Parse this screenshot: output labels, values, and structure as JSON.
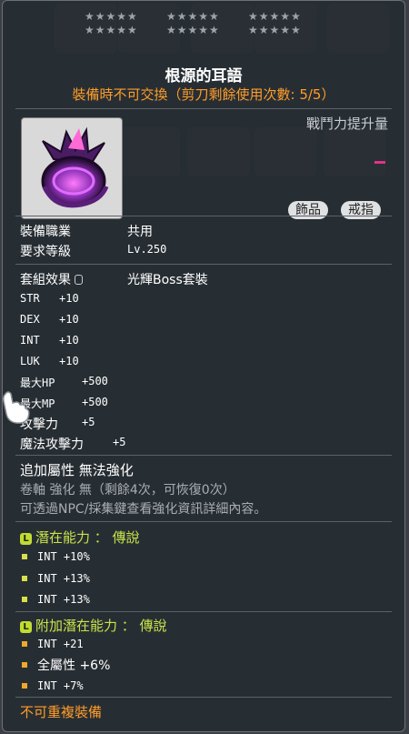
{
  "item": {
    "title": "根源的耳語",
    "trade_note": "裝備時不可交換（剪刀剩餘使用次數: 5/5）",
    "power_label": "戰鬥力提升量",
    "tags": [
      "飾品",
      "戒指"
    ]
  },
  "info": {
    "job_label": "裝備職業",
    "job_value": "共用",
    "level_label": "要求等級",
    "level_value": "Lv.250",
    "set_label": "套組效果",
    "set_value": "光輝Boss套裝"
  },
  "stats": [
    {
      "label": "STR",
      "value": "+10"
    },
    {
      "label": "DEX",
      "value": "+10"
    },
    {
      "label": "INT",
      "value": "+10"
    },
    {
      "label": "LUK",
      "value": "+10"
    },
    {
      "label": "最大HP",
      "value": "+500"
    },
    {
      "label": "最大MP",
      "value": "+500"
    },
    {
      "label": "攻擊力",
      "value": "+5"
    },
    {
      "label": "魔法攻擊力",
      "value": "+5"
    }
  ],
  "enhance": {
    "attr_line": "追加屬性 無法強化",
    "scroll_line": "卷軸 強化 無（剩餘4次，可恢復0次）",
    "npc_line": "可透過NPC/採集鍵查看強化資訊詳細內容。"
  },
  "potential": {
    "badge": "L",
    "title": "潛在能力 ： 傳說",
    "lines": [
      "INT +10%",
      "INT +13%",
      "INT +13%"
    ]
  },
  "bonus_potential": {
    "badge": "L",
    "title": "附加潛在能力 ： 傳說",
    "lines": [
      "INT +21",
      "全屬性 +6%",
      "INT +7%"
    ]
  },
  "footer": "不可重複裝備",
  "colors": {
    "potential": "#c9e34a",
    "trade_note": "#ff9c2a",
    "power_bar": "#e0338b"
  }
}
